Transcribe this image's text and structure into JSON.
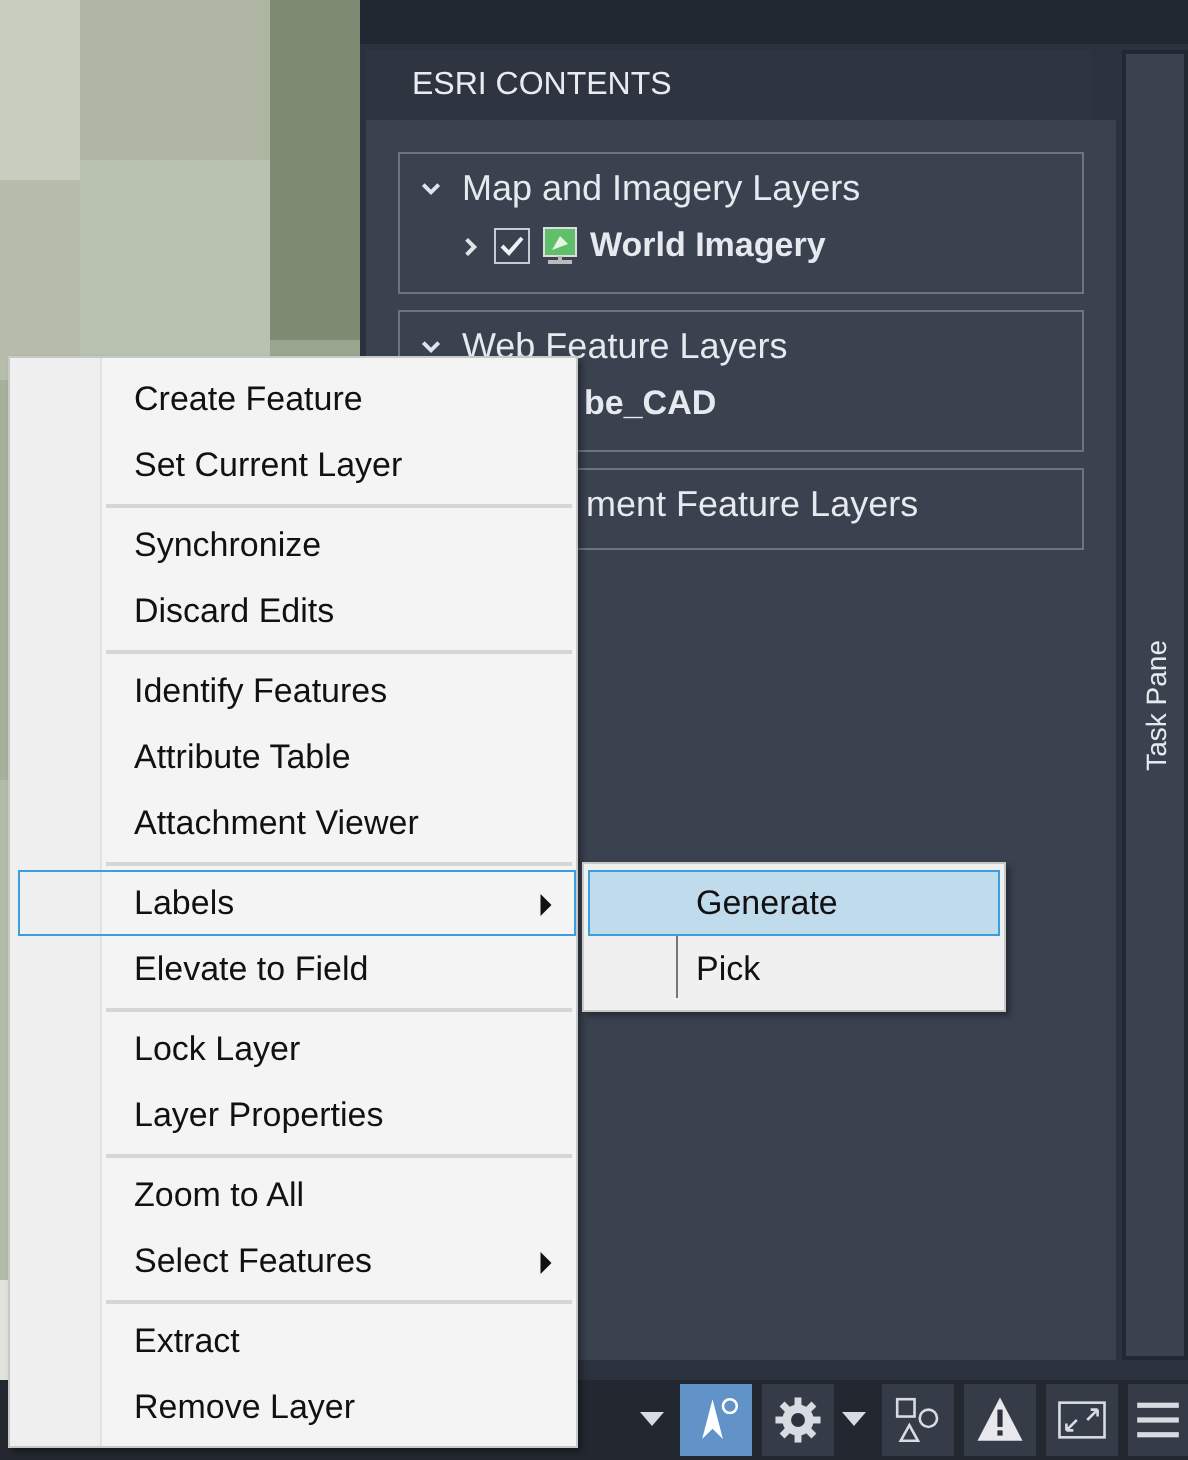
{
  "panel": {
    "title": "ESRI CONTENTS",
    "groups": [
      {
        "title": "Map and Imagery Layers",
        "expanded": true,
        "layers": [
          {
            "name": "World Imagery",
            "expanded": false,
            "checked": true
          }
        ]
      },
      {
        "title": "Web Feature Layers",
        "expanded": true,
        "layers": [
          {
            "name": "be_CAD"
          }
        ]
      },
      {
        "title": "ment Feature Layers"
      }
    ]
  },
  "task_pane": {
    "title": "Task Pane"
  },
  "context_menu": {
    "sections": [
      [
        {
          "label": "Create Feature",
          "selected": false,
          "submenu": false
        },
        {
          "label": "Set Current Layer",
          "selected": false,
          "submenu": false
        }
      ],
      [
        {
          "label": "Synchronize",
          "selected": false,
          "submenu": false
        },
        {
          "label": "Discard Edits",
          "selected": false,
          "submenu": false
        }
      ],
      [
        {
          "label": "Identify Features",
          "selected": false,
          "submenu": false
        },
        {
          "label": "Attribute Table",
          "selected": false,
          "submenu": false
        },
        {
          "label": "Attachment Viewer",
          "selected": false,
          "submenu": false
        }
      ],
      [
        {
          "label": "Labels",
          "selected": true,
          "submenu": true
        },
        {
          "label": "Elevate to Field",
          "selected": false,
          "submenu": false
        }
      ],
      [
        {
          "label": "Lock Layer",
          "selected": false,
          "submenu": false
        },
        {
          "label": "Layer Properties",
          "selected": false,
          "submenu": false
        }
      ],
      [
        {
          "label": "Zoom to All",
          "selected": false,
          "submenu": false
        },
        {
          "label": "Select Features",
          "selected": false,
          "submenu": true
        }
      ],
      [
        {
          "label": "Extract",
          "selected": false,
          "submenu": false
        },
        {
          "label": "Remove Layer",
          "selected": false,
          "submenu": false
        }
      ]
    ]
  },
  "submenu": {
    "items": [
      {
        "label": "Generate",
        "selected": true
      },
      {
        "label": "Pick",
        "selected": false
      }
    ]
  },
  "toolbar": {
    "buttons": [
      {
        "kind": "caret",
        "selected": false
      },
      {
        "kind": "tracking",
        "selected": true
      },
      {
        "kind": "gear",
        "selected": false
      },
      {
        "kind": "caret",
        "selected": false
      },
      {
        "kind": "shapes",
        "selected": false
      },
      {
        "kind": "warning",
        "selected": false
      },
      {
        "kind": "fullscreen",
        "selected": false
      },
      {
        "kind": "menu",
        "selected": false
      }
    ]
  }
}
